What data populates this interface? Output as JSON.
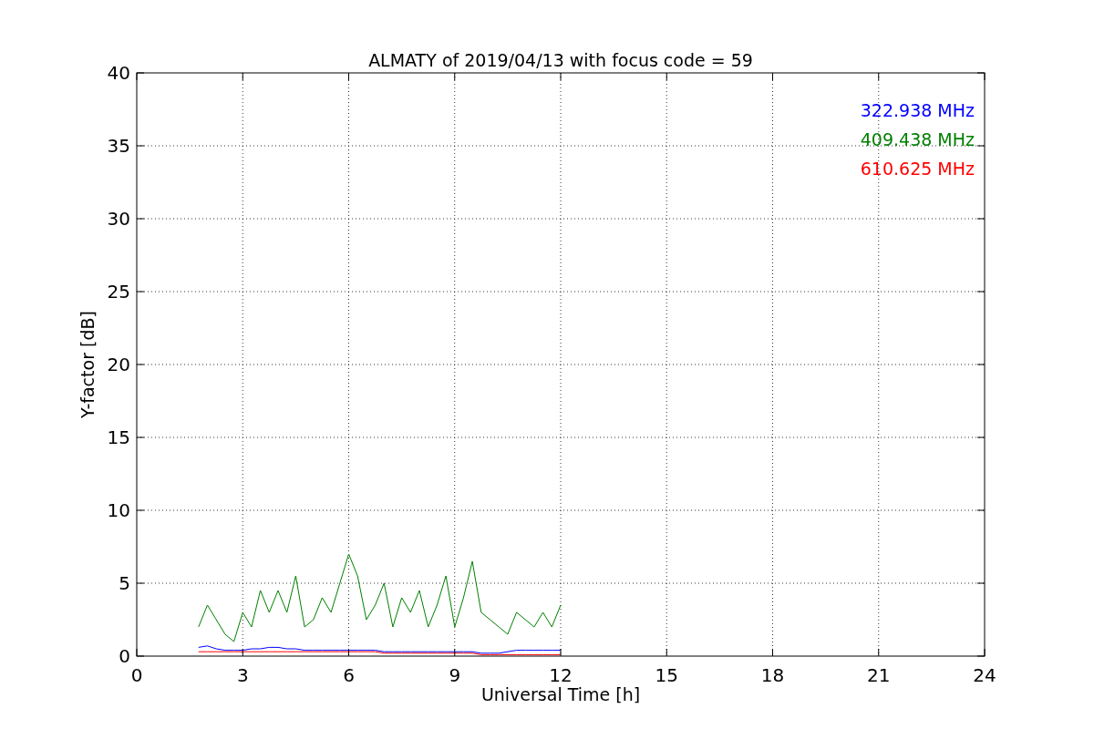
{
  "chart_data": {
    "type": "line",
    "title": "ALMATY of 2019/04/13 with focus code = 59",
    "xlabel": "Universal Time [h]",
    "ylabel": "Y-factor [dB]",
    "x": [
      1.75,
      2.0,
      2.25,
      2.5,
      2.75,
      3.0,
      3.25,
      3.5,
      3.75,
      4.0,
      4.25,
      4.5,
      4.75,
      5.0,
      5.25,
      5.5,
      5.75,
      6.0,
      6.25,
      6.5,
      6.75,
      7.0,
      7.25,
      7.5,
      7.75,
      8.0,
      8.25,
      8.5,
      8.75,
      9.0,
      9.25,
      9.5,
      9.75,
      10.0,
      10.25,
      10.5,
      10.75,
      11.0,
      11.25,
      11.5,
      11.75,
      12.0
    ],
    "series": [
      {
        "name": "322.938 MHz",
        "color": "#0000ff",
        "values": [
          0.6,
          0.7,
          0.5,
          0.4,
          0.4,
          0.4,
          0.5,
          0.5,
          0.6,
          0.6,
          0.5,
          0.5,
          0.4,
          0.4,
          0.4,
          0.4,
          0.4,
          0.4,
          0.4,
          0.4,
          0.4,
          0.3,
          0.3,
          0.3,
          0.3,
          0.3,
          0.3,
          0.3,
          0.3,
          0.3,
          0.3,
          0.3,
          0.2,
          0.2,
          0.2,
          0.3,
          0.4,
          0.4,
          0.4,
          0.4,
          0.4,
          0.4
        ]
      },
      {
        "name": "409.438 MHz",
        "color": "#008000",
        "values": [
          2.0,
          3.5,
          2.5,
          1.5,
          1.0,
          3.0,
          2.0,
          4.5,
          3.0,
          4.5,
          3.0,
          5.5,
          2.0,
          2.5,
          4.0,
          3.0,
          5.0,
          7.0,
          5.5,
          2.5,
          3.5,
          5.0,
          2.0,
          4.0,
          3.0,
          4.5,
          2.0,
          3.5,
          5.5,
          2.0,
          4.0,
          6.5,
          3.0,
          2.5,
          2.0,
          1.5,
          3.0,
          2.5,
          2.0,
          3.0,
          2.0,
          3.5
        ]
      },
      {
        "name": "610.625 MHz",
        "color": "#ff0000",
        "values": [
          0.3,
          0.3,
          0.3,
          0.3,
          0.3,
          0.3,
          0.3,
          0.3,
          0.3,
          0.3,
          0.3,
          0.3,
          0.3,
          0.3,
          0.3,
          0.3,
          0.3,
          0.3,
          0.3,
          0.3,
          0.3,
          0.2,
          0.2,
          0.2,
          0.2,
          0.2,
          0.2,
          0.2,
          0.2,
          0.2,
          0.2,
          0.2,
          0.1,
          0.1,
          0.1,
          0.1,
          0.1,
          0.1,
          0.1,
          0.1,
          0.1,
          0.1
        ]
      }
    ],
    "xlim": [
      0,
      24
    ],
    "ylim": [
      0,
      40
    ],
    "xticks": [
      0,
      3,
      6,
      9,
      12,
      15,
      18,
      21,
      24
    ],
    "yticks": [
      0,
      5,
      10,
      15,
      20,
      25,
      30,
      35,
      40
    ],
    "grid": true
  }
}
